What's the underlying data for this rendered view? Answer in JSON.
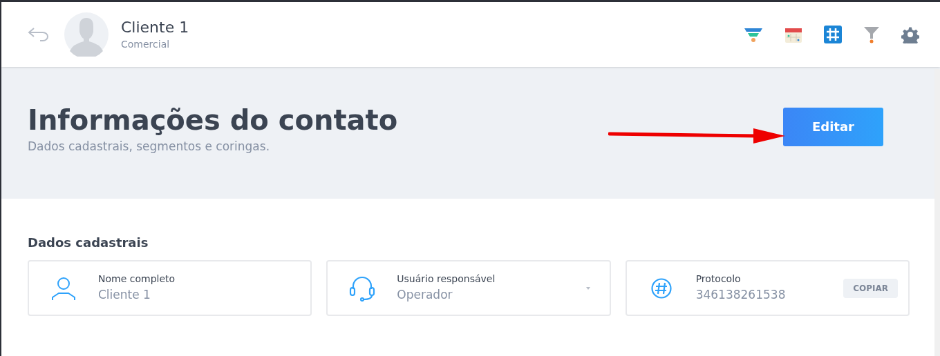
{
  "header": {
    "name": "Cliente 1",
    "role": "Comercial"
  },
  "hero": {
    "title": "Informações do contato",
    "subtitle": "Dados cadastrais, segmentos e coringas.",
    "button": "Editar"
  },
  "section": {
    "title": "Dados cadastrais",
    "fields": [
      {
        "kind": "person",
        "label": "Nome completo",
        "value": "Cliente 1"
      },
      {
        "kind": "dropdown",
        "label": "Usuário responsável",
        "value": "Operador"
      },
      {
        "kind": "copy",
        "label": "Protocolo",
        "value": "346138261538",
        "action": "COPIAR"
      }
    ]
  }
}
